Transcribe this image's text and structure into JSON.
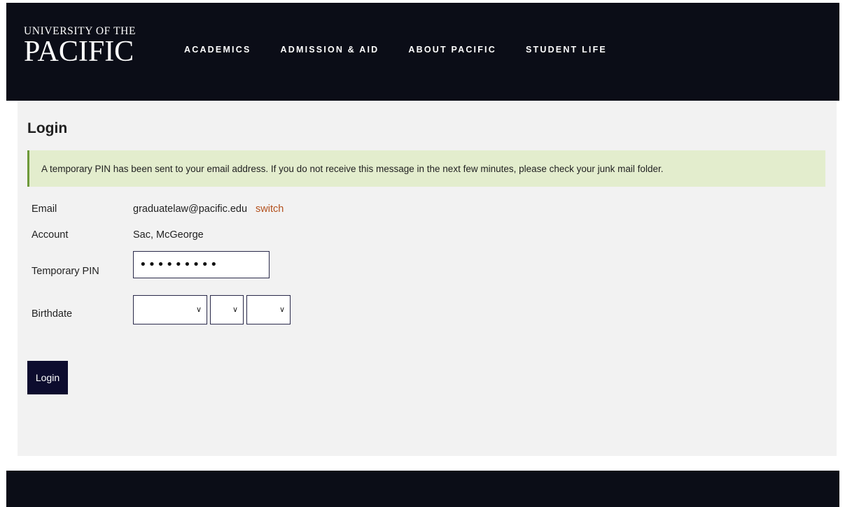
{
  "header": {
    "logo_top": "UNIVERSITY OF THE",
    "logo_main": "PACIFIC",
    "nav": [
      "ACADEMICS",
      "ADMISSION & AID",
      "ABOUT PACIFIC",
      "STUDENT LIFE"
    ]
  },
  "main": {
    "title": "Login",
    "alert": "A temporary PIN has been sent to your email address. If you do not receive this message in the next few minutes, please check your junk mail folder.",
    "email_label": "Email",
    "email_value": "graduatelaw@pacific.edu",
    "switch_label": "switch",
    "account_label": "Account",
    "account_value": "Sac, McGeorge",
    "pin_label": "Temporary PIN",
    "pin_value": "•••••••••",
    "birthdate_label": "Birthdate",
    "login_button": "Login"
  },
  "colors": {
    "header_bg": "#0b0d17",
    "alert_bg": "#e3edcd",
    "alert_border": "#6e9a3b",
    "link": "#b3501d",
    "button_bg": "#0d0c2e"
  }
}
